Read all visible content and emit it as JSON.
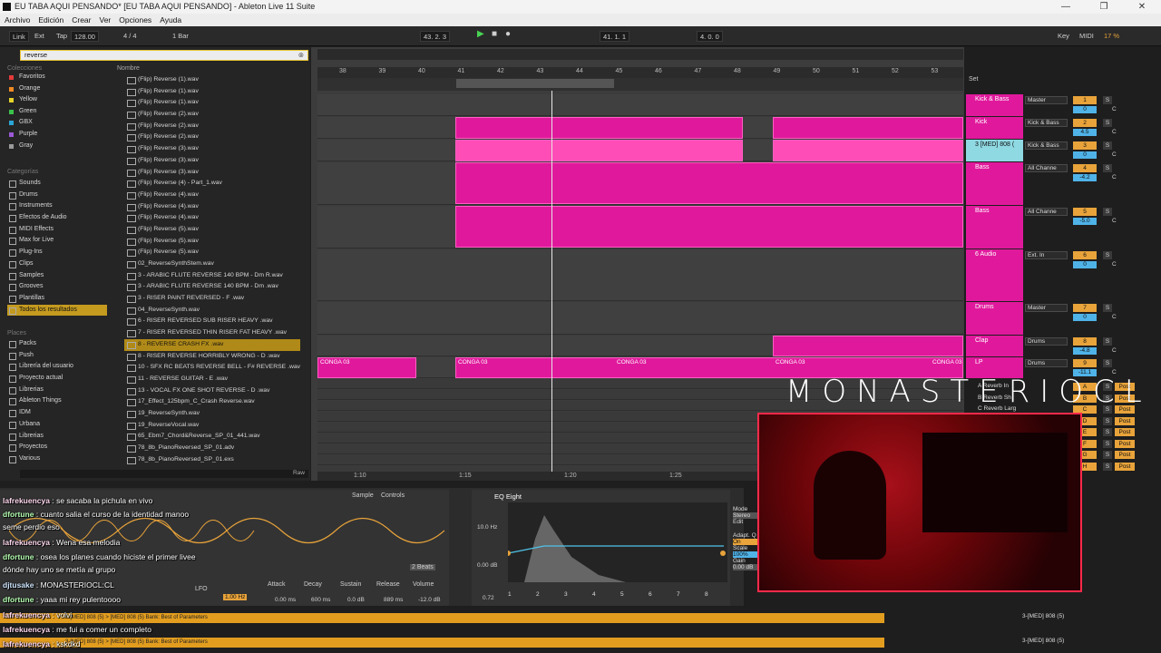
{
  "window": {
    "title": "EU TABA AQUI PENSANDO* [EU TABA AQUI PENSANDO] - Ableton Live 11 Suite",
    "min": "—",
    "max": "❐",
    "close": "✕"
  },
  "menu": [
    "Archivo",
    "Edición",
    "Crear",
    "Ver",
    "Opciones",
    "Ayuda"
  ],
  "control": {
    "link": "Link",
    "ext": "Ext",
    "tap": "Tap",
    "tempo": "128.00",
    "signature": "4 / 4",
    "quant": "1 Bar",
    "position": "43.  2.  3",
    "loop_start": "41.  1.  1",
    "loop_length": "4.  0.  0",
    "key": "Key",
    "midi": "MIDI",
    "cpu": "17 %"
  },
  "browser": {
    "search": "reverse",
    "collections_header": "Colecciones",
    "collections": [
      {
        "label": "Favoritos",
        "color": "#e63a3a"
      },
      {
        "label": "Orange",
        "color": "#f08a24"
      },
      {
        "label": "Yellow",
        "color": "#e6d22a"
      },
      {
        "label": "Green",
        "color": "#3ac24a"
      },
      {
        "label": "GBX",
        "color": "#2aa6d6"
      },
      {
        "label": "Purple",
        "color": "#9b59d6"
      },
      {
        "label": "Gray",
        "color": "#9a9a9a"
      }
    ],
    "categories_header": "Categorías",
    "categories": [
      "Sounds",
      "Drums",
      "Instruments",
      "Efectos de Audio",
      "MIDI Effects",
      "Max for Live",
      "Plug-Ins",
      "Clips",
      "Samples",
      "Grooves",
      "Plantillas",
      "Todos los resultados"
    ],
    "places_header": "Places",
    "places": [
      "Packs",
      "Push",
      "Librería del usuario",
      "Proyecto actual",
      "Librerias",
      "Ableton Things",
      "IDM",
      "Urbana",
      "Librerias",
      "Proyectos",
      "Various"
    ],
    "name_header": "Nombre",
    "files": [
      "(Flip) Reverse (1).wav",
      "(Flip) Reverse (1).wav",
      "(Flip) Reverse (1).wav",
      "(Flip) Reverse (2).wav",
      "(Flip) Reverse (2).wav",
      "(Flip) Reverse (2).wav",
      "(Flip) Reverse (3).wav",
      "(Flip) Reverse (3).wav",
      "(Flip) Reverse (3).wav",
      "(Flip) Reverse (4) - Part_1.wav",
      "(Flip) Reverse (4).wav",
      "(Flip) Reverse (4).wav",
      "(Flip) Reverse (4).wav",
      "(Flip) Reverse (5).wav",
      "(Flip) Reverse (5).wav",
      "(Flip) Reverse (5).wav",
      "02_ReverseSynthStem.wav",
      "3 - ARABIC FLUTE REVERSE 140 BPM - Dm R.wav",
      "3 - ARABIC FLUTE REVERSE 140 BPM - Dm .wav",
      "3 - RISER PAINT REVERSED - F .wav",
      "04_ReverseSynth.wav",
      "6 - RISER REVERSED SUB RISER HEAVY .wav",
      "7 - RISER REVERSED THIN RISER FAT HEAVY .wav",
      "8 - REVERSE CRASH FX .wav",
      "8 - RISER REVERSE HORRIBLY WRONG - D .wav",
      "10 - SFX RC BEATS REVERSE BELL - F# REVERSE .wav",
      "11 - REVERSE GUITAR - E .wav",
      "13 - VOCAL FX ONE SHOT REVERSE - D .wav",
      "17_Effect_125bpm_C_Crash Reverse.wav",
      "19_ReverseSynth.wav",
      "19_ReverseVocal.wav",
      "65_Ebm7_Chord&Reverse_SP_01_441.wav",
      "78_8b_PianoReversed_SP_01.adv",
      "78_8b_PianoReversed_SP_01.exs"
    ],
    "raw": "Raw"
  },
  "ruler": [
    "38",
    "39",
    "40",
    "41",
    "42",
    "43",
    "44",
    "45",
    "46",
    "47",
    "48",
    "49",
    "50",
    "51",
    "52",
    "53"
  ],
  "time_ruler": [
    "1:10",
    "1:15",
    "1:20",
    "1:25"
  ],
  "set_label": "Set",
  "tracks": [
    {
      "name": "Kick & Bass",
      "input": "Master",
      "num": "1",
      "vol": "0",
      "pan": "C"
    },
    {
      "name": "Kick",
      "input": "Kick & Bass",
      "num": "2",
      "vol": "4.5",
      "pan": "C"
    },
    {
      "name": "3 [MED] 808 (",
      "input": "Kick & Bass",
      "num": "3",
      "vol": "0",
      "pan": "C"
    },
    {
      "name": "Bass",
      "input": "All Channe",
      "num": "4",
      "vol": "-4.2",
      "pan": "C"
    },
    {
      "name": "Bass",
      "input": "All Channe",
      "num": "5",
      "vol": "-5.0",
      "pan": "C"
    },
    {
      "name": "6 Audio",
      "input": "Ext. In",
      "num": "6",
      "vol": "0",
      "pan": "C"
    },
    {
      "name": "Drums",
      "input": "Master",
      "num": "7",
      "vol": "0",
      "pan": "C"
    },
    {
      "name": "Clap",
      "input": "Drums",
      "num": "8",
      "vol": "-4.8",
      "pan": "C"
    },
    {
      "name": "LP",
      "input": "Drums",
      "num": "9",
      "vol": "-11.1",
      "pan": "C"
    }
  ],
  "returns": [
    "A",
    "B",
    "C",
    "D",
    "E",
    "F",
    "G",
    "H"
  ],
  "return_names": [
    "A Reverb In",
    "B Reverb Sh",
    "C Reverb Larg"
  ],
  "clip_labels": [
    "CONGA 03",
    "CONGA 03",
    "CONGA 03",
    "CONGA 03",
    "CONGA 03"
  ],
  "device": {
    "sample_tab": "Sample",
    "controls_tab": "Controls",
    "eq_title": "EQ Eight",
    "freq": "10.0 Hz",
    "gain": "0.00 dB",
    "q": "0.72",
    "attack": "Attack",
    "decay": "Decay",
    "sustain": "Sustain",
    "release": "Release",
    "volume": "Volume",
    "attack_v": "0.00 ms",
    "decay_v": "600 ms",
    "sustain_v": "0.0 dB",
    "release_v": "889 ms",
    "volume_v": "-12.0 dB",
    "lfo": "LFO",
    "lfo_rate": "1.00 Hz",
    "beats": "2 Beats",
    "mode": "Mode",
    "stereo": "Stereo",
    "edit": "Edit",
    "adapt": "Adapt. Q",
    "on": "On",
    "scale": "Scale",
    "scale_v": "100%",
    "out_gain": "Gain",
    "out_gain_v": "0.00 dB",
    "eq_bands": [
      "1",
      "2",
      "3",
      "4",
      "5",
      "6",
      "7",
      "8"
    ]
  },
  "streamer": "MONASTERIOCL",
  "chat": [
    {
      "user": "lafrekuencya",
      "msg": "se sacaba la pichula en vivo",
      "cls": "u-pink"
    },
    {
      "user": "dfortune",
      "msg": "cuanto salia el curso de la identidad manoo",
      "cls": "u-green"
    },
    {
      "user": "",
      "msg": "seme perdio eso",
      "cls": ""
    },
    {
      "user": "lafrekuencya",
      "msg": "Wena esa melodia",
      "cls": "u-pink"
    },
    {
      "user": "dfortune",
      "msg": "osea los planes cuando hiciste el primer livee",
      "cls": "u-green"
    },
    {
      "user": "",
      "msg": "dónde hay uno se metía al grupo",
      "cls": ""
    },
    {
      "user": "djtusake",
      "msg": "MONASTERIOCL:CL",
      "cls": "u-blue"
    },
    {
      "user": "dfortune",
      "msg": "yaaa mi rey pulentoooo",
      "cls": "u-green"
    },
    {
      "user": "lafrekuencya",
      "msg": "volvi",
      "cls": "u-pink"
    },
    {
      "user": "lafrekuencya",
      "msg": "me fui a comer un completo",
      "cls": "u-pink"
    },
    {
      "user": "lafrekuencya",
      "msg": "kskdkd",
      "cls": "u-pink"
    }
  ],
  "status": {
    "bank": "3-[MED] 808 (5) > [MED] 808 (5) Bank: Best of Parameters",
    "right": "3-[MED] 808 (5)"
  },
  "colors": {
    "clip": "#e0199c",
    "accent": "#e8a33a",
    "select": "#c49a1f",
    "webcam_border": "#ff2a4a"
  }
}
